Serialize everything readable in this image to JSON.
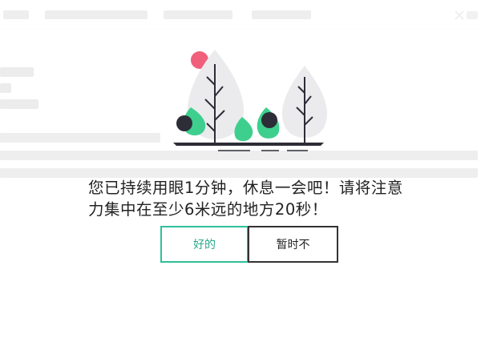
{
  "dialog": {
    "message": "您已持续用眼1分钟，休息一会吧！请将注意力集中在至少6米远的地方20秒！",
    "ok_label": "好的",
    "later_label": "暂时不"
  },
  "colors": {
    "accent": "#2fbf98",
    "leaf_green": "#3ecf8e",
    "sun_pink": "#f0607a",
    "ground": "#2d2d38",
    "tree_grey": "#e9e9ec"
  },
  "icons": [
    "close-icon"
  ]
}
